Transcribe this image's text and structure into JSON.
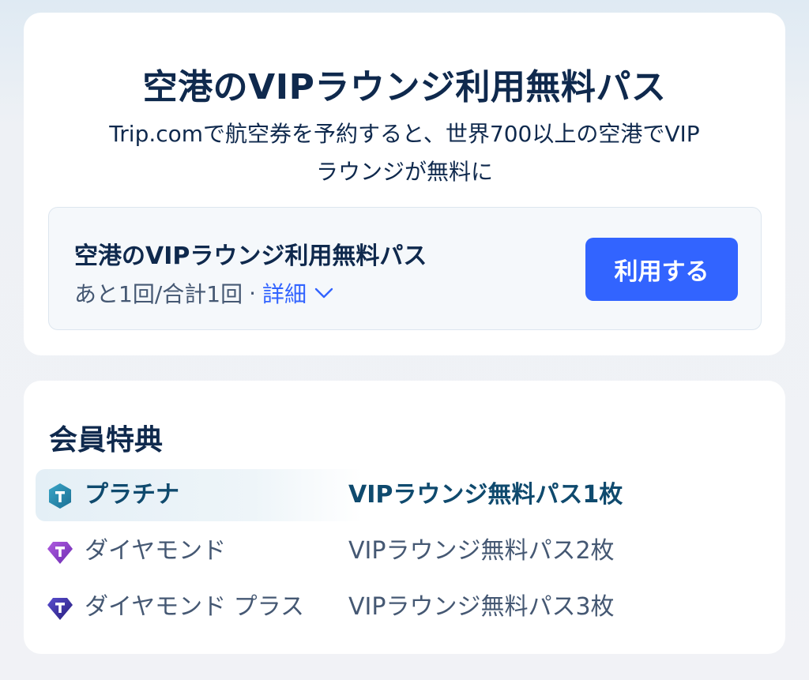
{
  "hero": {
    "title": "空港のVIPラウンジ利用無料パス",
    "description_line1": "Trip.comで航空券を予約すると、世界700以上の空港でVIP",
    "description_line2": "ラウンジが無料に"
  },
  "pass": {
    "title": "空港のVIPラウンジ利用無料パス",
    "usage": "あと1回/合計1回",
    "separator": "·",
    "detail_label": "詳細",
    "button_label": "利用する"
  },
  "benefits": {
    "title": "会員特典",
    "tiers": [
      {
        "name": "プラチナ",
        "benefit": "VIPラウンジ無料パス1枚",
        "icon": "platinum-badge-icon",
        "active": true
      },
      {
        "name": "ダイヤモンド",
        "benefit": "VIPラウンジ無料パス2枚",
        "icon": "diamond-badge-icon",
        "active": false
      },
      {
        "name": "ダイヤモンド プラス",
        "benefit": "VIPラウンジ無料パス3枚",
        "icon": "diamond-plus-badge-icon",
        "active": false
      }
    ]
  },
  "colors": {
    "accent": "#3264ff",
    "text_primary": "#0f294d",
    "text_secondary": "#455873"
  }
}
